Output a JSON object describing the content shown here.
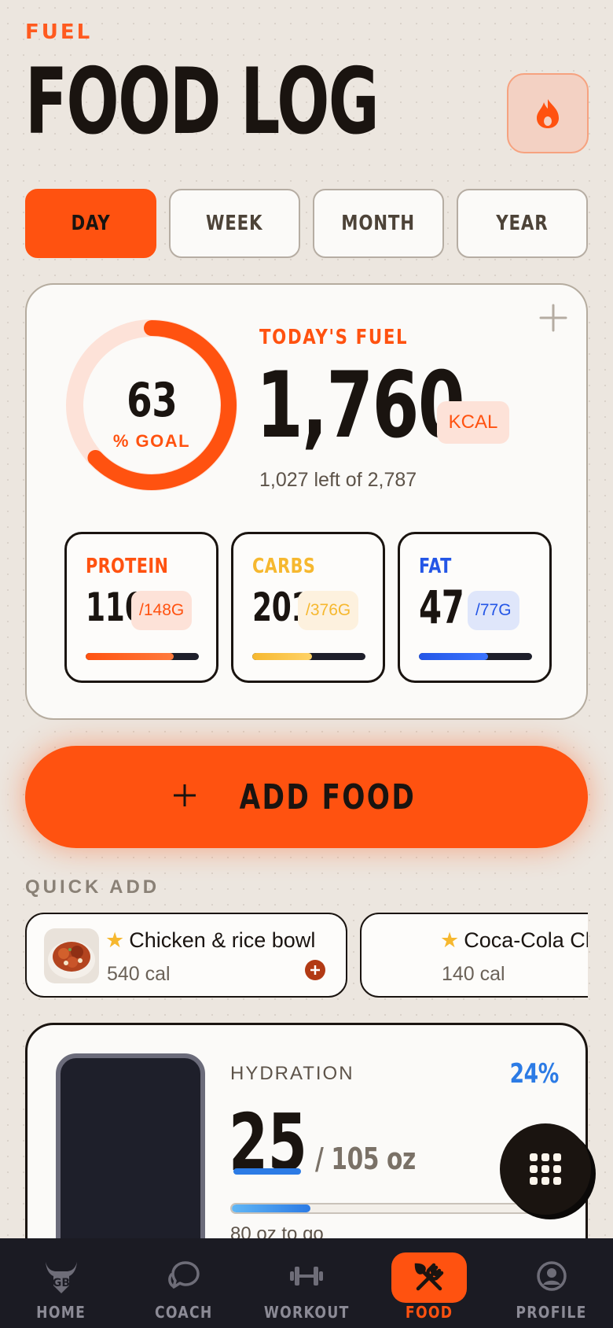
{
  "header": {
    "eyebrow": "FUEL",
    "title": "FOOD LOG"
  },
  "tabs": [
    {
      "label": "DAY",
      "active": true
    },
    {
      "label": "WEEK",
      "active": false
    },
    {
      "label": "MONTH",
      "active": false
    },
    {
      "label": "YEAR",
      "active": false
    }
  ],
  "summary": {
    "goal_percent": "63",
    "goal_label": "% GOAL",
    "goal_fraction": 0.63,
    "fuel_label": "TODAY'S FUEL",
    "calories": "1,760",
    "unit": "KCAL",
    "remaining": "1,027 left of 2,787"
  },
  "macros": [
    {
      "name": "PROTEIN",
      "value": "116",
      "goal": "/148G",
      "fraction": 0.78,
      "color": "#ff5210"
    },
    {
      "name": "CARBS",
      "value": "201",
      "goal": "/376G",
      "fraction": 0.53,
      "color": "#f6b82f"
    },
    {
      "name": "FAT",
      "value": "47",
      "goal": "/77G",
      "fraction": 0.61,
      "color": "#2456e6"
    }
  ],
  "add_food": {
    "label": "ADD FOOD"
  },
  "quick_add": {
    "title": "QUICK ADD",
    "items": [
      {
        "name": "Chicken & rice bowl",
        "calories": "540 cal"
      },
      {
        "name": "Coca-Cola Classic",
        "calories": "140 cal"
      }
    ]
  },
  "hydration": {
    "label": "HYDRATION",
    "percent": "24%",
    "value": "25",
    "unit": "/ 105 oz",
    "to_go": "80 oz to go",
    "fraction": 0.24
  },
  "nav": [
    {
      "label": "HOME",
      "icon": "bull-logo-icon",
      "active": false
    },
    {
      "label": "COACH",
      "icon": "chat-bubble-icon",
      "active": false
    },
    {
      "label": "WORKOUT",
      "icon": "dumbbell-icon",
      "active": false
    },
    {
      "label": "FOOD",
      "icon": "fork-knife-icon",
      "active": true
    },
    {
      "label": "PROFILE",
      "icon": "user-circle-icon",
      "active": false
    }
  ],
  "colors": {
    "accent": "#ff5210",
    "background": "#ece6df",
    "protein": "#ff5210",
    "carbs": "#f6b82f",
    "fat": "#2456e6",
    "water": "#2c7be5",
    "nav_bg": "#1b1b23"
  }
}
